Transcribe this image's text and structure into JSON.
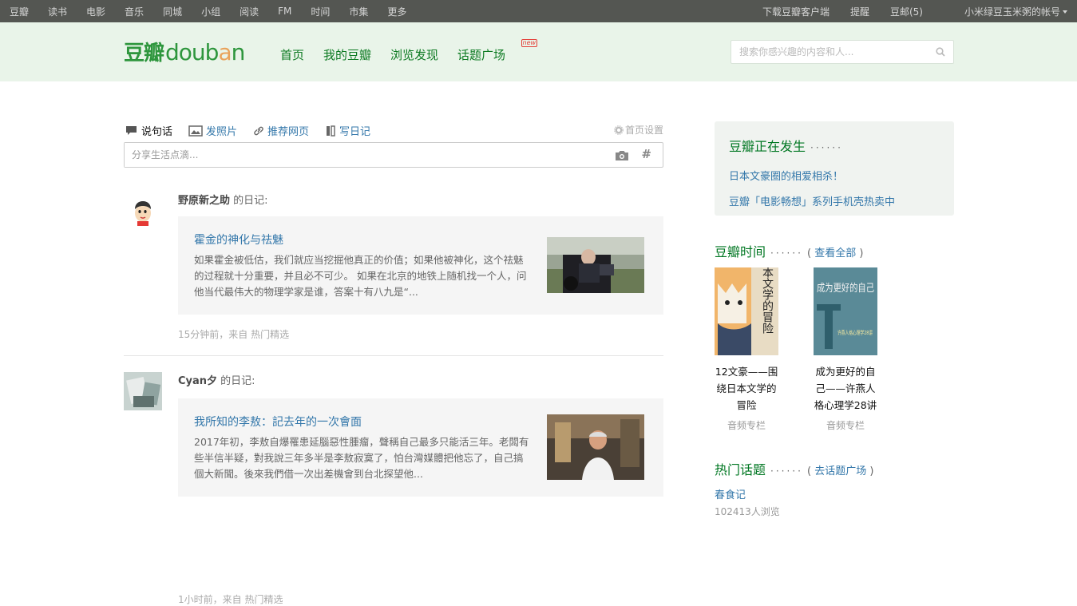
{
  "global_nav": {
    "left": [
      "豆瓣",
      "读书",
      "电影",
      "音乐",
      "同城",
      "小组",
      "阅读",
      "FM",
      "时间",
      "市集",
      "更多"
    ],
    "right": {
      "download": "下载豆瓣客户端",
      "remind": "提醒",
      "mail": "豆邮(5)",
      "account": "小米绿豆玉米粥的帐号"
    }
  },
  "header": {
    "logo_cn": "豆瓣",
    "logo_en_1": "doub",
    "logo_en_2": "a",
    "logo_en_3": "n",
    "nav": [
      "首页",
      "我的豆瓣",
      "浏览发现",
      "话题广场"
    ],
    "new_badge": "new",
    "search_placeholder": "搜索你感兴趣的内容和人..."
  },
  "composer": {
    "tabs": [
      "说句话",
      "发照片",
      "推荐网页",
      "写日记"
    ],
    "settings": "首页设置",
    "placeholder": "分享生活点滴..."
  },
  "feed": [
    {
      "user": "野原新之助",
      "action": " 的日记:",
      "title": "霍金的神化与祛魅",
      "excerpt": "如果霍金被低估，我们就应当挖掘他真正的价值；如果他被神化，这个祛魅的过程就十分重要，并且必不可少。 如果在北京的地铁上随机找一个人，问他当代最伟大的物理学家是谁，答案十有八九是“...",
      "time": "15分钟前，来自",
      "source": " 热门精选"
    },
    {
      "user": "Cyan夕",
      "action": " 的日记:",
      "title": "我所知的李敖：記去年的一次會面",
      "excerpt": "2017年初，李敖自爆罹患延腦惡性腫瘤，聲稱自己最多只能活三年。老闆有些半信半疑，對我說三年多半是李敖寂寞了，怕台灣媒體把他忘了，自己搞個大新聞。後來我們借一次出差機會到台北探望他...",
      "time": "1小时前，来自",
      "source": " 热门精选"
    }
  ],
  "aside": {
    "happening": {
      "title": "豆瓣正在发生",
      "items": [
        "日本文豪圈的相爱相杀！",
        "豆瓣「电影畅想」系列手机壳热卖中"
      ]
    },
    "time": {
      "title": "豆瓣时间",
      "more": "查看全部",
      "books": [
        {
          "title": "12文豪——围绕日本文学的冒险",
          "type": "音频专栏",
          "cover_text": "围绕日本文学的冒险"
        },
        {
          "title": "成为更好的自己——许燕人格心理学28讲",
          "type": "音频专栏",
          "cover_text": "成为更好的自己",
          "cover_sub": "许燕人格心理学28讲"
        }
      ]
    },
    "topics": {
      "title": "热门话题",
      "more": "去话题广场",
      "items": [
        {
          "name": "春食记",
          "stat": "102413人浏览"
        }
      ]
    }
  }
}
